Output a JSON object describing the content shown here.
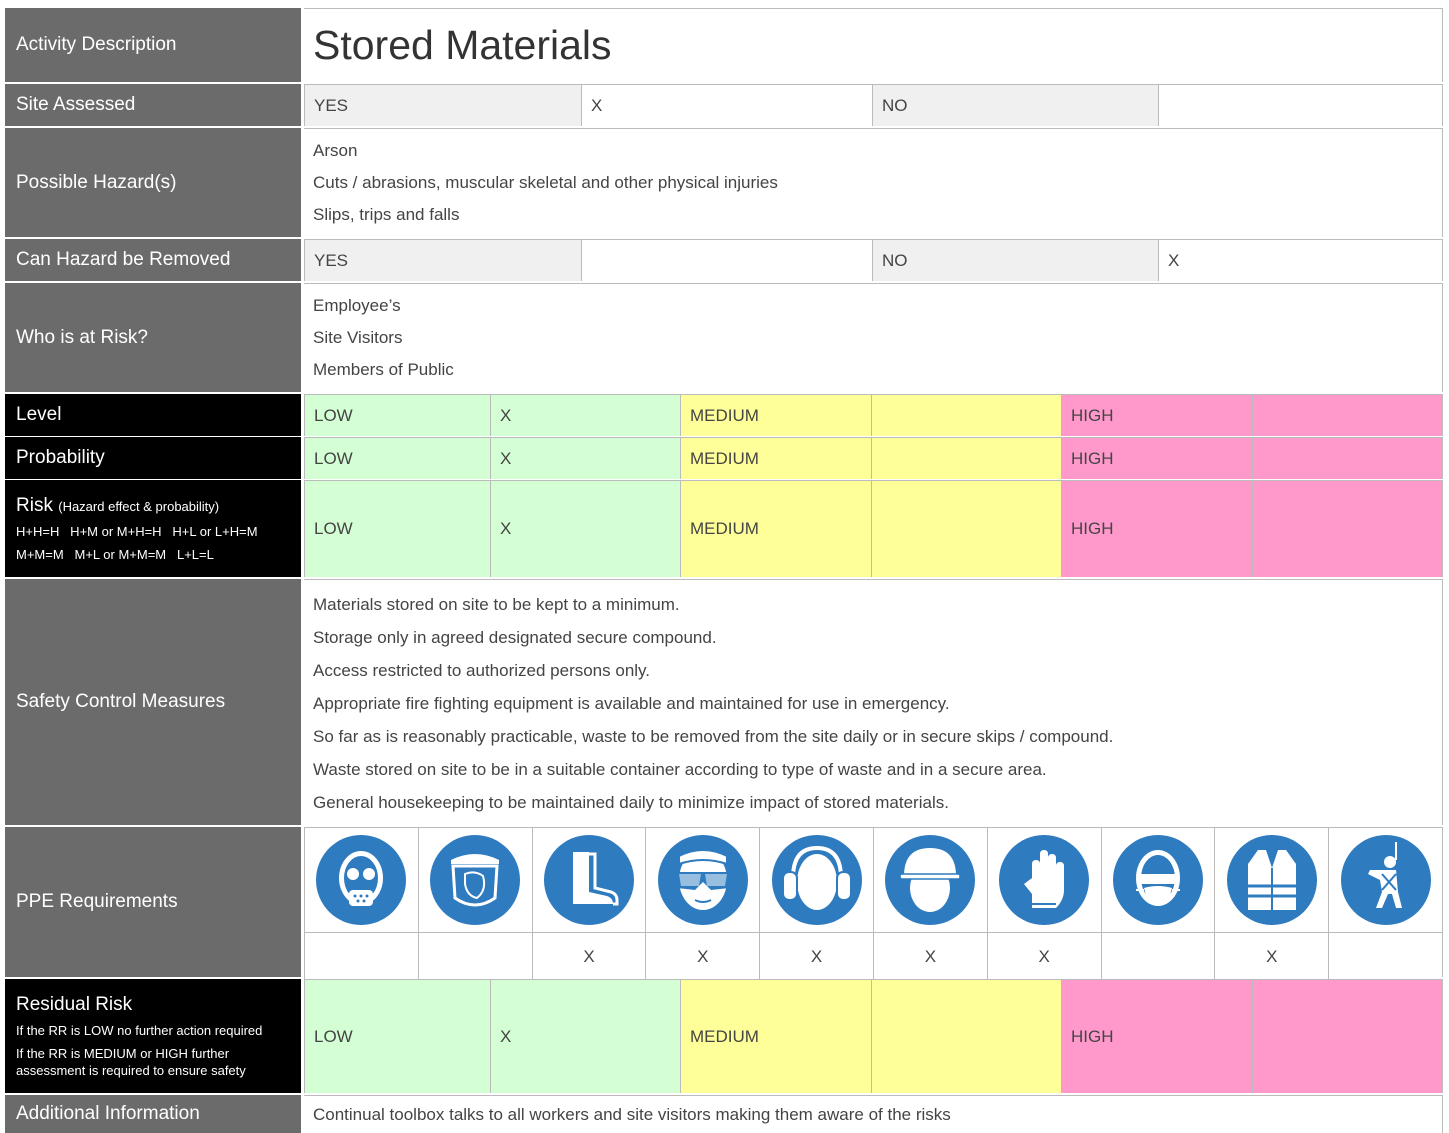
{
  "activity": {
    "label": "Activity Description",
    "title": "Stored Materials"
  },
  "site_assessed": {
    "label": "Site Assessed",
    "yes": "YES",
    "yes_mark": "X",
    "no": "NO",
    "no_mark": ""
  },
  "hazards": {
    "label": "Possible Hazard(s)",
    "items": [
      "Arson",
      "Cuts / abrasions, muscular skeletal and other physical injuries",
      "Slips, trips and falls"
    ]
  },
  "removed": {
    "label": "Can Hazard be Removed",
    "yes": "YES",
    "yes_mark": "",
    "no": "NO",
    "no_mark": "X"
  },
  "risk_who": {
    "label": "Who is at Risk?",
    "items": [
      "Employee’s",
      "Site Visitors",
      "Members of Public"
    ]
  },
  "level": {
    "label": "Level",
    "low": "LOW",
    "low_mark": "X",
    "medium": "MEDIUM",
    "medium_mark": "",
    "high": "HIGH",
    "high_mark": ""
  },
  "probability": {
    "label": "Probability",
    "low": "LOW",
    "low_mark": "X",
    "medium": "MEDIUM",
    "medium_mark": "",
    "high": "HIGH",
    "high_mark": ""
  },
  "risk": {
    "label": "Risk",
    "label_note": "(Hazard effect & probability)",
    "line1": "H+H=H   H+M or M+H=H   H+L or L+H=M",
    "line2": "M+M=M   M+L or M+M=M   L+L=L",
    "low": "LOW",
    "low_mark": "X",
    "medium": "MEDIUM",
    "medium_mark": "",
    "high": "HIGH",
    "high_mark": ""
  },
  "controls": {
    "label": "Safety Control Measures",
    "items": [
      "Materials stored on site to be kept to a minimum.",
      "Storage only in agreed designated secure compound.",
      "Access restricted to authorized persons only.",
      "Appropriate fire fighting equipment is available and maintained for use in emergency.",
      "So far as is reasonably practicable, waste to be removed from the site daily or in secure skips / compound.",
      "Waste stored on site to be in a suitable container according to type of waste and in a secure area.",
      "General housekeeping to be maintained daily to minimize impact of stored materials."
    ]
  },
  "ppe": {
    "label": "PPE Requirements",
    "icon_color": "#2f7bbf",
    "icons": [
      "respirator-icon",
      "face-shield-icon",
      "safety-boots-icon",
      "safety-glasses-icon",
      "ear-defenders-icon",
      "hard-hat-icon",
      "gloves-icon",
      "dust-mask-icon",
      "hi-vis-vest-icon",
      "harness-icon"
    ],
    "marks": [
      "",
      "",
      "X",
      "X",
      "X",
      "X",
      "X",
      "",
      "X",
      ""
    ]
  },
  "residual": {
    "label": "Residual Risk",
    "note1": "If the RR is LOW no further action required",
    "note2": "If the RR is MEDIUM or HIGH further assessment is required to ensure safety",
    "low": "LOW",
    "low_mark": "X",
    "medium": "MEDIUM",
    "medium_mark": "",
    "high": "HIGH",
    "high_mark": ""
  },
  "additional": {
    "label": "Additional Information",
    "text": "Continual toolbox talks to all workers and site visitors making them aware of the risks"
  }
}
